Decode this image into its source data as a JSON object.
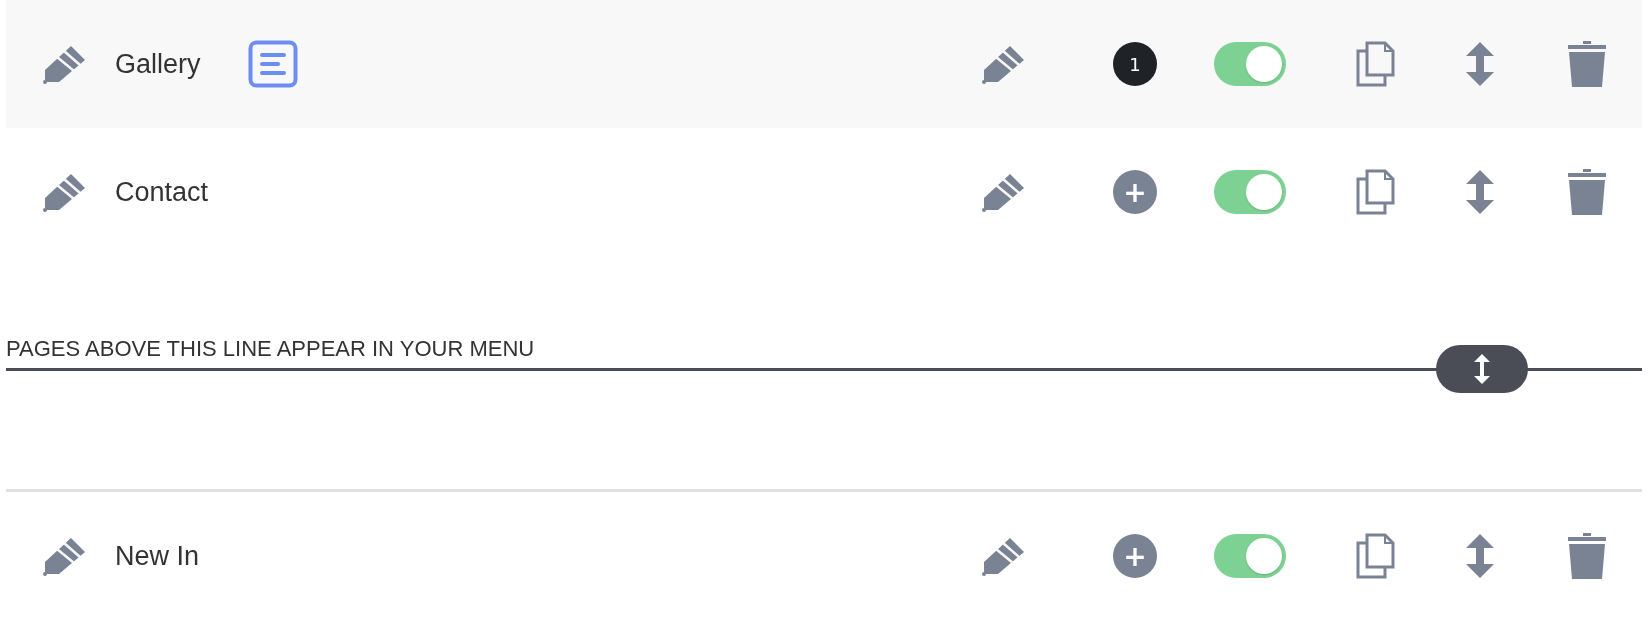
{
  "menu_pages": [
    {
      "name": "Gallery",
      "highlighted": true,
      "has_note": true,
      "badge": {
        "kind": "count",
        "text": "1"
      },
      "on": true
    },
    {
      "name": "Contact",
      "highlighted": false,
      "has_note": false,
      "badge": {
        "kind": "add",
        "text": "+"
      },
      "on": true
    }
  ],
  "divider": {
    "label": "PAGES ABOVE THIS LINE APPEAR IN YOUR MENU"
  },
  "other_pages": [
    {
      "name": "New In",
      "highlighted": false,
      "has_note": false,
      "badge": {
        "kind": "add",
        "text": "+"
      },
      "on": true
    }
  ]
}
